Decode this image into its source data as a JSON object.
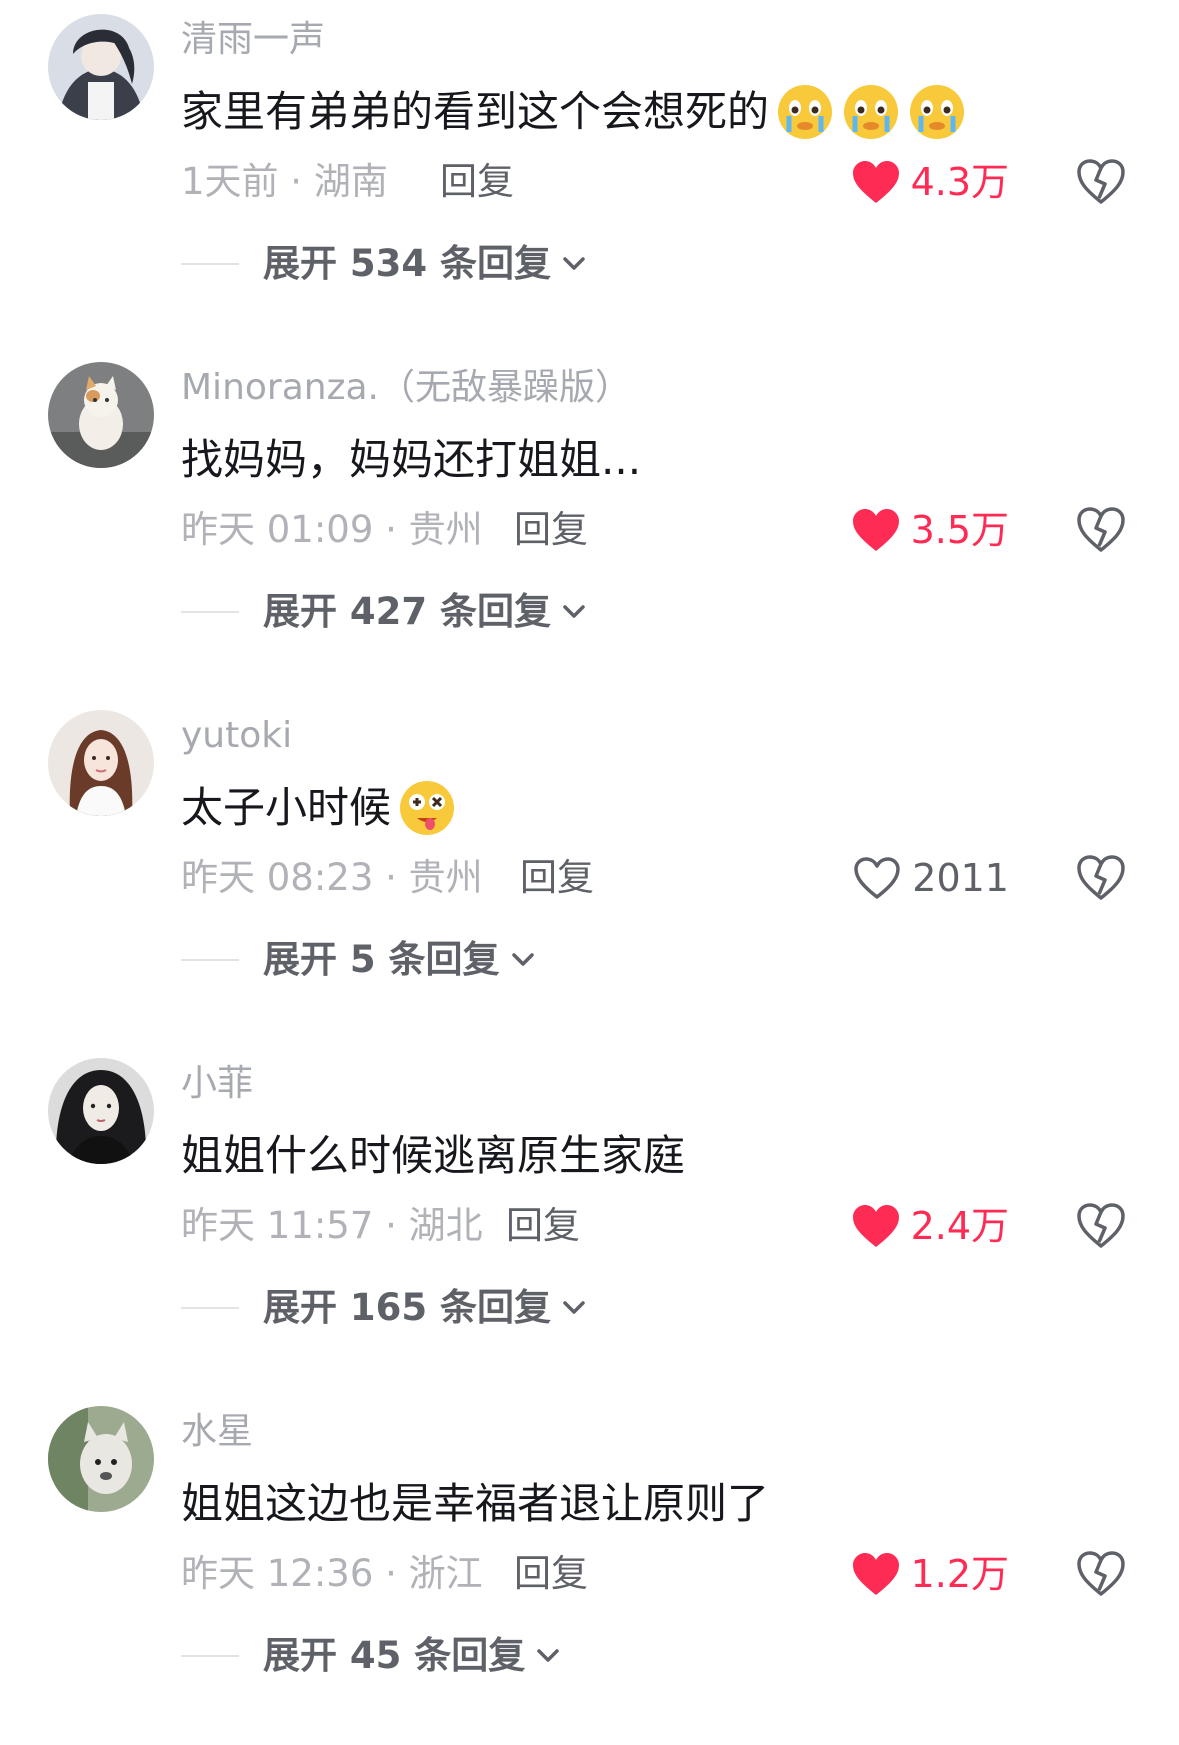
{
  "comments": [
    {
      "username": "清雨一声",
      "content": "家里有弟弟的看到这个会想死的",
      "emoji": [
        "crying-face-emoji",
        "crying-face-emoji",
        "crying-face-emoji"
      ],
      "meta": "1天前 · 湖南",
      "reply_label": "回复",
      "likes": "4.3万",
      "liked": true,
      "expand_label": "展开 534 条回复",
      "avatar": "anime-boy-avatar"
    },
    {
      "username": "Minoranza.（无敌暴躁版）",
      "content": "找妈妈，妈妈还打姐姐...",
      "emoji": [],
      "meta": "昨天 01:09 · 贵州",
      "reply_label": "回复",
      "likes": "3.5万",
      "liked": true,
      "expand_label": "展开 427 条回复",
      "avatar": "cat-avatar"
    },
    {
      "username": "yutoki",
      "content": "太子小时候",
      "emoji": [
        "dizzy-face-emoji"
      ],
      "meta": "昨天 08:23 · 贵州",
      "reply_label": "回复",
      "likes": "2011",
      "liked": false,
      "expand_label": "展开 5 条回复",
      "avatar": "girl-avatar"
    },
    {
      "username": "小菲",
      "content": "姐姐什么时候逃离原生家庭",
      "emoji": [],
      "meta": "昨天 11:57 · 湖北",
      "reply_label": "回复",
      "likes": "2.4万",
      "liked": true,
      "expand_label": "展开 165 条回复",
      "avatar": "dark-hair-avatar"
    },
    {
      "username": "水星",
      "content": "姐姐这边也是幸福者退让原则了",
      "emoji": [],
      "meta": "昨天 12:36 · 浙江",
      "reply_label": "回复",
      "likes": "1.2万",
      "liked": true,
      "expand_label": "展开 45 条回复",
      "avatar": "cartoon-dog-avatar"
    }
  ],
  "colors": {
    "like_red": "#fe2c55",
    "meta_gray": "#b0b2b8",
    "text_dark": "#16181d"
  }
}
